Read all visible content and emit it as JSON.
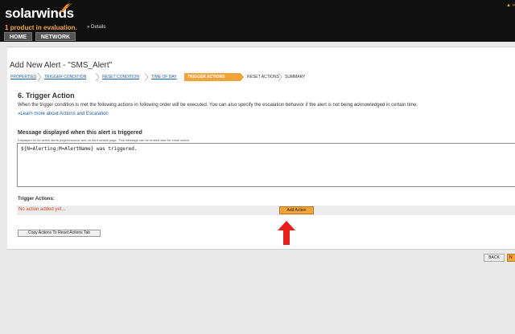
{
  "header": {
    "brand": "solarwinds",
    "eval_text": "1 product in evaluation.",
    "details": "» Details",
    "user": "▲ »",
    "nav": {
      "home": "HOME",
      "network": "NETWORK"
    }
  },
  "page": {
    "title": "Add New Alert - \"SMS_Alert\""
  },
  "wizard": {
    "steps": [
      {
        "label": "PROPERTIES"
      },
      {
        "label": "TRIGGER CONDITION"
      },
      {
        "label": "RESET CONDITION"
      },
      {
        "label": "TIME OF DAY"
      },
      {
        "label": "TRIGGER ACTIONS"
      },
      {
        "label": "RESET ACTIONS"
      },
      {
        "label": "SUMMARY"
      }
    ]
  },
  "section": {
    "title": "6. Trigger Action",
    "intro": "When the trigger condition is met the following actions in following order will be executed. You can also specify the escalation behavior if the alert is not being acknowledged in certain time.",
    "learn_more": "»Learn more about Actions and Escalation"
  },
  "message": {
    "label": "Message displayed when this alert is triggered",
    "help": "Displayed on All active alerts page/resource and on Alert details page. This message can be reused also for email action.",
    "value": "${N=Alerting;M=AlertName} was triggered."
  },
  "trigger_actions": {
    "label": "Trigger Actions:",
    "empty_text": "No action added yet...",
    "add_label": "Add Action",
    "copy_label": "Copy Actions To Reset Actions Tab"
  },
  "footer": {
    "back_label": "BACK",
    "next_label": "N"
  },
  "colors": {
    "accent": "#f4a23a",
    "header_bg": "#101010",
    "link": "#1a5ea8",
    "warning_text": "#d04a1f",
    "arrow": "#e8201a"
  }
}
